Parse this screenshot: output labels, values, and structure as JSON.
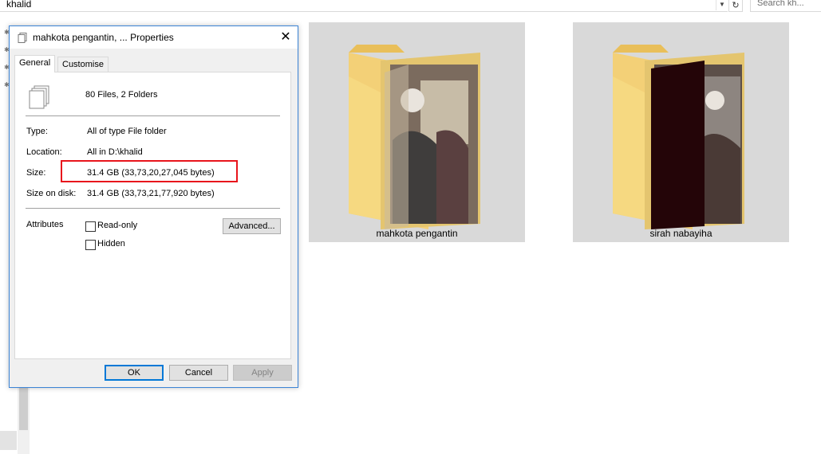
{
  "explorer": {
    "address": "khalid",
    "search_placeholder": "Search kh...",
    "folders": [
      {
        "name": "mahkota pengantin"
      },
      {
        "name": "sirah nabayiha"
      }
    ]
  },
  "dialog": {
    "title": "mahkota pengantin, ... Properties",
    "close_glyph": "✕",
    "tabs": [
      {
        "label": "General",
        "active": true
      },
      {
        "label": "Customise",
        "active": false
      }
    ],
    "summary": "80 Files, 2 Folders",
    "fields": {
      "type_label": "Type:",
      "type_value": "All of type File folder",
      "location_label": "Location:",
      "location_value": "All in D:\\khalid",
      "size_label": "Size:",
      "size_value": "31.4 GB (33,73,20,27,045 bytes)",
      "size_on_disk_label": "Size on disk:",
      "size_on_disk_value": "31.4 GB (33,73,21,77,920 bytes)"
    },
    "attributes": {
      "label": "Attributes",
      "readonly_label": "Read-only",
      "readonly_checked": false,
      "hidden_label": "Hidden",
      "hidden_checked": false,
      "advanced_label": "Advanced..."
    },
    "buttons": {
      "ok": "OK",
      "cancel": "Cancel",
      "apply": "Apply"
    },
    "highlight_color": "#e8151c"
  }
}
